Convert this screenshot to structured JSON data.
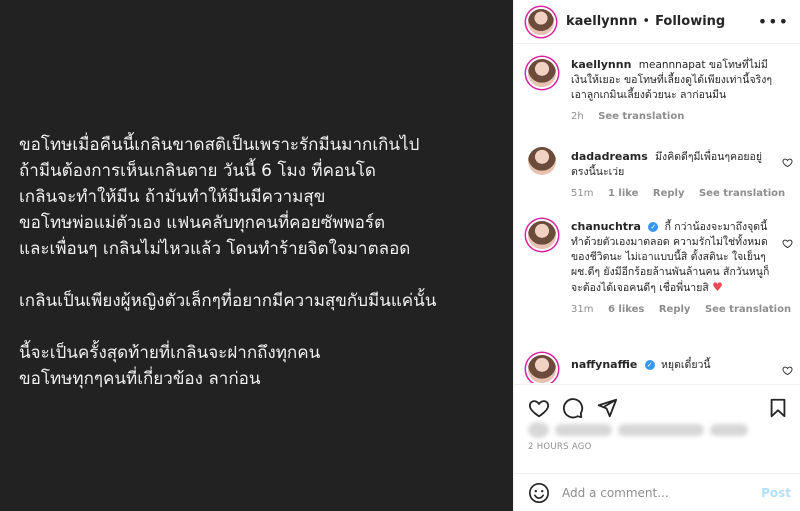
{
  "post": {
    "paragraphs": [
      [
        "ขอโทษเมื่อคืนนี้เกลินขาดสติเป็นเพราะรักมีนมากเกินไป",
        "ถ้ามีนต้องการเห็นเกลินตาย วันนี้ 6 โมง ที่คอนโด",
        "เกลินจะทำให้มีน ถ้ามันทำให้มีนมีความสุข",
        "ขอโทษพ่อแม่ตัวเอง แฟนคลับทุกคนที่คอยซัพพอร์ต",
        "และเพื่อนๆ เกลินไม่ไหวแล้ว โดนทำร้ายจิตใจมาตลอด"
      ],
      [
        "เกลินเป็นเพียงผู้หญิงตัวเล็กๆที่อยากมีความสุขกับมีนแค่นั้น"
      ],
      [
        "นี้จะเป็นครั้งสุดท้ายที่เกลินจะฝากถึงทุกคน",
        "ขอโทษทุกๆคนที่เกี่ยวข้อง ลาก่อน"
      ]
    ]
  },
  "header": {
    "username": "kaellynnn",
    "dot": "•",
    "following": "Following",
    "more": "•••"
  },
  "comments": [
    {
      "username": "kaellynnn",
      "mention": "meannnapat",
      "text": "ขอโทษที่ไม่มีเงินให้เยอะ ขอโทษที่เลี้ยงดูได้เพียงเท่านี้จริงๆ เอาลูกเกมินเลี้ยงด้วยนะ ลาก่อนมีน",
      "time": "2h",
      "translate": "See translation"
    },
    {
      "username": "dadadreams",
      "text": "มึงคิดดีๆมีเพื่อนๆคอยอยู่ตรงนี้นะเว่ย",
      "time": "51m",
      "likes": "1 like",
      "reply": "Reply",
      "translate": "See translation"
    },
    {
      "username": "chanuchtra",
      "text": "กี้ กว่าน้องจะมาถึงจุดนี้ทำด้วยตัวเองมาตลอด ความรักไม่ใช่ทั้งหมดของชีวิตนะ ไม่เอาแบบนี้สิ ตั้งสตินะ ใจเย็นๆ ผช.ดีๆ ยังมีอีกร้อยล้านพันล้านคน สักวันหนูก็จะต้องได้เจอคนดีๆ เชื่อพี่นายสิ",
      "heart": "♥",
      "time": "31m",
      "likes": "6 likes",
      "reply": "Reply",
      "translate": "See translation"
    },
    {
      "username": "naffynaffie",
      "text": "หยุดเดี๋ยวนี้"
    }
  ],
  "actions": {
    "timestamp": "2 HOURS AGO"
  },
  "comment_box": {
    "placeholder": "Add a comment...",
    "post": "Post"
  },
  "colors": {
    "post_bg": "#222222",
    "accent_blue": "#3897f0",
    "heart_red": "#ed4956",
    "secondary_text": "#8e8e8e"
  },
  "icons": {
    "like": "heart-outline-icon",
    "comment": "speech-bubble-icon",
    "share": "paper-plane-icon",
    "save": "bookmark-icon",
    "emoji": "smiley-icon",
    "comment_like": "small-heart-icon",
    "verified": "verified-badge-icon"
  }
}
